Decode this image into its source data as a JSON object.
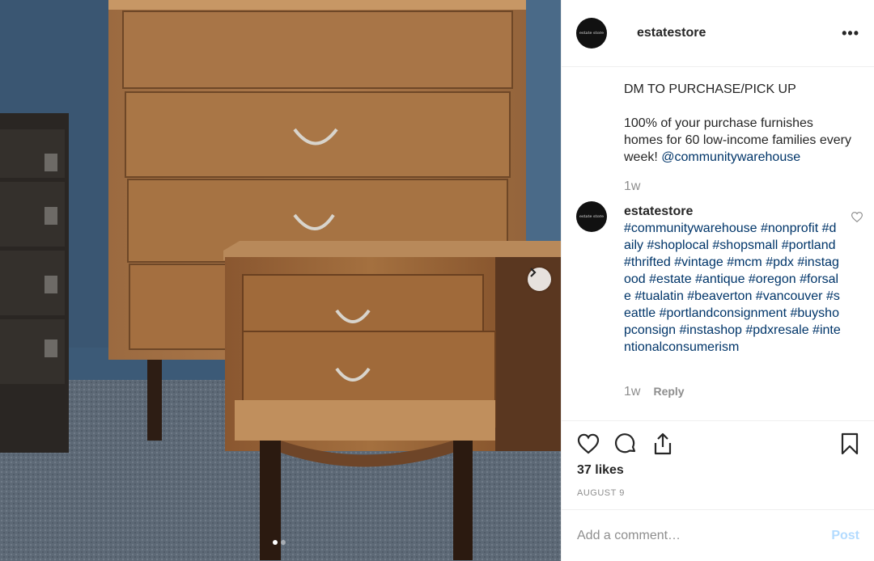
{
  "post": {
    "username": "estatestore",
    "avatar_text": "estate store",
    "caption": "DM TO PURCHASE/PICK UP\n\n100% of your purchase furnishes homes for 60 low-income families every week! ",
    "caption_mention": "@communitywarehouse",
    "caption_time": "1w",
    "likes": "37 likes",
    "date": "AUGUST 9"
  },
  "comment": {
    "username": "estatestore",
    "text": "#communitywarehouse #nonprofit #daily #shoplocal #shopsmall #portland #thrifted #vintage #mcm #pdx #instagood #estate #antique #oregon #forsale #tualatin #beaverton #vancouver #seattle #portlandconsignment #buyshopconsign #instashop #pdxresale #intentionalconsumerism",
    "time": "1w",
    "reply_label": "Reply"
  },
  "add_comment": {
    "placeholder": "Add a comment…",
    "post_label": "Post"
  },
  "carousel": {
    "current": 1,
    "total": 2
  },
  "icons": {
    "more": "more-options-icon",
    "like": "heart-icon",
    "comment": "comment-bubble-icon",
    "share": "share-icon",
    "save": "bookmark-icon",
    "next": "chevron-right-icon"
  },
  "colors": {
    "link": "#003569",
    "muted": "#8e8e8e",
    "post_disabled": "#b3dbff"
  }
}
